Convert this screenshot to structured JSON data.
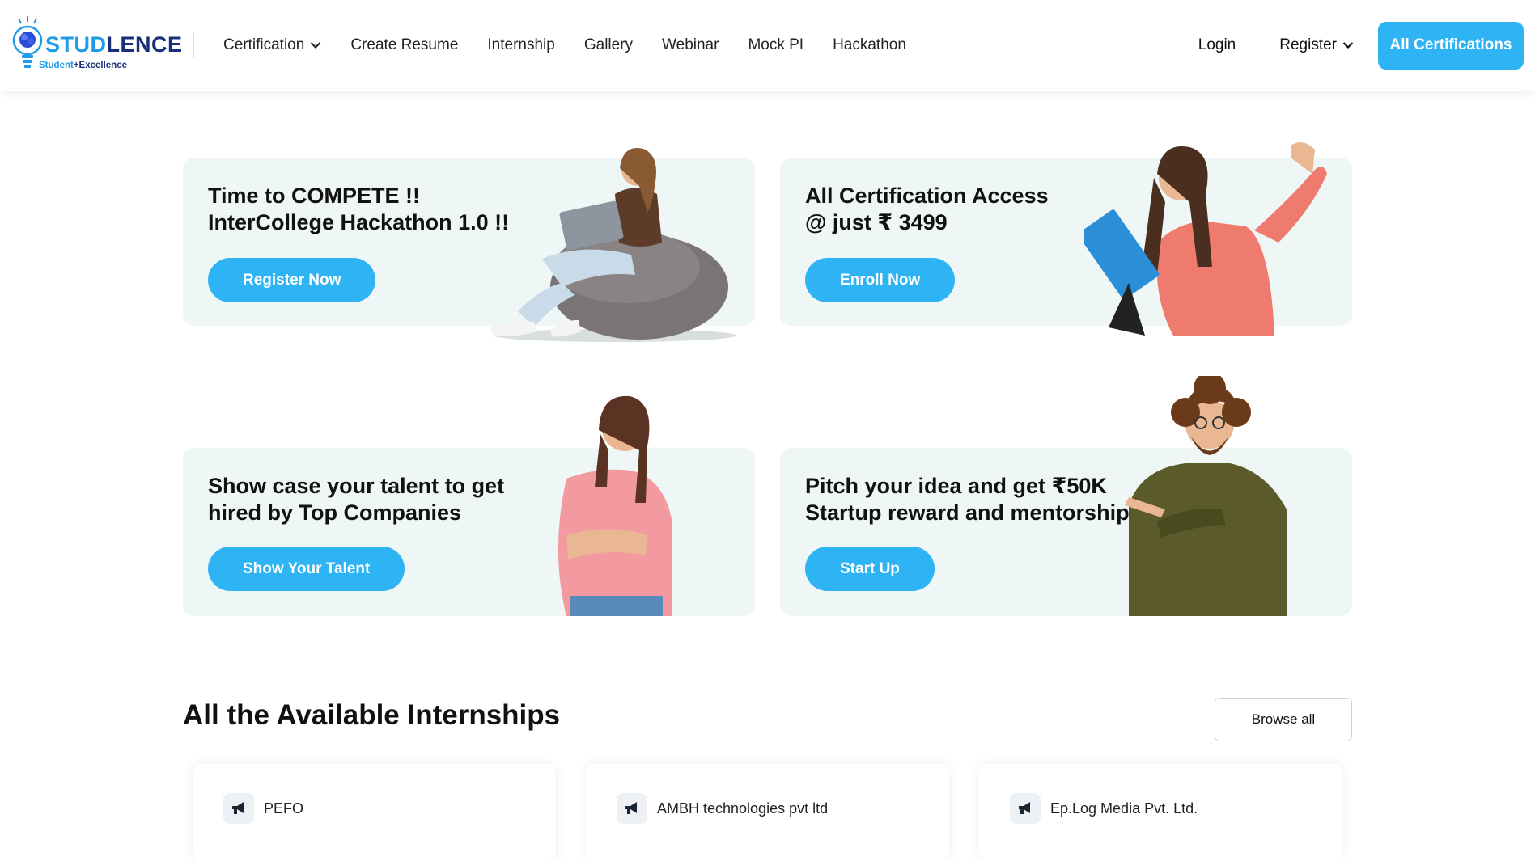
{
  "brand": {
    "name_part1": "STUD",
    "name_part2": "LENCE",
    "tagline_part1": "Student",
    "tagline_part2": "+Excellence"
  },
  "nav": {
    "items": [
      {
        "label": "Certification",
        "has_dropdown": true
      },
      {
        "label": "Create Resume",
        "has_dropdown": false
      },
      {
        "label": "Internship",
        "has_dropdown": false
      },
      {
        "label": "Gallery",
        "has_dropdown": false
      },
      {
        "label": "Webinar",
        "has_dropdown": false
      },
      {
        "label": "Mock PI",
        "has_dropdown": false
      },
      {
        "label": "Hackathon",
        "has_dropdown": false
      }
    ],
    "login_label": "Login",
    "register_label": "Register",
    "cta_label": "All Certifications"
  },
  "promos": [
    {
      "title": "Time to COMPETE !!\nInterCollege Hackathon 1.0 !!",
      "button": "Register Now"
    },
    {
      "title": "All Certification Access\n@ just ₹ 3499",
      "button": "Enroll Now"
    },
    {
      "title": "Show case your talent to get\nhired by Top Companies",
      "button": "Show Your Talent"
    },
    {
      "title": "Pitch your idea and get ₹50K\nStartup reward and mentorship.",
      "button": "Start Up"
    }
  ],
  "internships": {
    "title": "All the Available Internships",
    "browse_label": "Browse all",
    "items": [
      {
        "company": "PEFO"
      },
      {
        "company": "AMBH technologies pvt ltd"
      },
      {
        "company": "Ep.Log Media Pvt. Ltd."
      }
    ]
  },
  "colors": {
    "accent": "#2eb3f5",
    "card_bg": "#eff6f6",
    "brand_light": "#1e9be8",
    "brand_dark": "#1a2f7a"
  }
}
